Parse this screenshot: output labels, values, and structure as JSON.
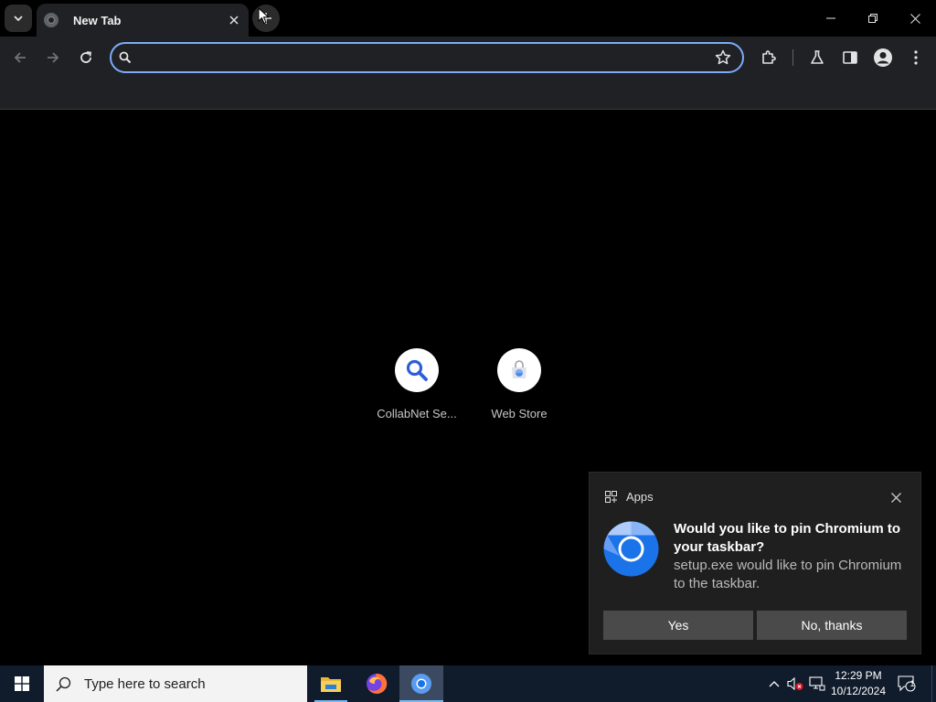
{
  "browser": {
    "tab": {
      "title": "New Tab"
    },
    "omnibox": {
      "value": "",
      "placeholder": ""
    }
  },
  "shortcuts": [
    {
      "label": "CollabNet Se...",
      "icon": "search-icon"
    },
    {
      "label": "Web Store",
      "icon": "web-store-icon"
    }
  ],
  "notification": {
    "app_name": "Apps",
    "title": "Would you like to pin Chromium to your taskbar?",
    "body": "setup.exe would like to pin Chromium to the taskbar.",
    "yes_label": "Yes",
    "no_label": "No, thanks"
  },
  "taskbar": {
    "search_placeholder": "Type here to search",
    "apps": [
      "file-explorer-icon",
      "firefox-icon",
      "chromium-icon"
    ],
    "clock": {
      "time": "12:29 PM",
      "date": "10/12/2024"
    },
    "notification_count": "1"
  },
  "colors": {
    "accent": "#7cacf8",
    "taskbar": "#101b2c",
    "toolbar": "#202124",
    "toast_button": "#4a4a4a"
  }
}
